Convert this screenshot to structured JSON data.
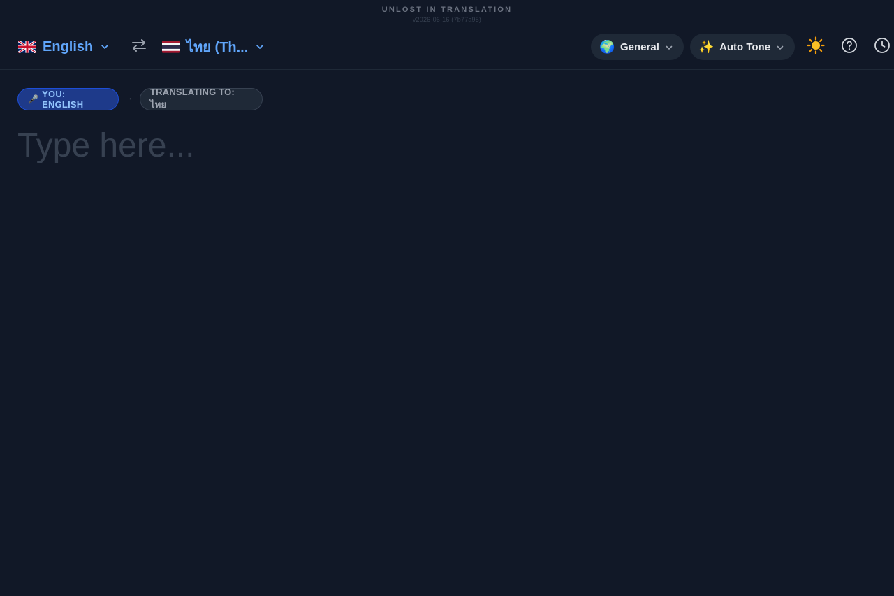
{
  "app": {
    "title": "UNLOST IN TRANSLATION",
    "version": "v2026-06-16 (7b77a95)"
  },
  "header": {
    "source_language": {
      "flag": "uk-flag",
      "label": "English"
    },
    "swap_icon": "swap-arrows-icon",
    "target_language": {
      "flag": "thailand-flag",
      "label": "ไทย (Th..."
    },
    "mode": {
      "emoji": "🌍",
      "label": "General"
    },
    "tone": {
      "emoji": "✨",
      "label": "Auto Tone"
    },
    "theme_icon": "☀️",
    "help_icon": "help-circle-icon",
    "history_icon": "clock-icon"
  },
  "chips": {
    "you": {
      "icon": "🎤",
      "label": "YOU: ENGLISH"
    },
    "arrow": "→",
    "target": {
      "label": "TRANSLATING TO: ไทย"
    }
  },
  "editor": {
    "placeholder": "Type here...",
    "value": ""
  },
  "colors": {
    "background": "#111827",
    "accent": "#60a5fa",
    "pill_bg": "#1f2937",
    "chip_you_bg": "#1e3a8a"
  }
}
